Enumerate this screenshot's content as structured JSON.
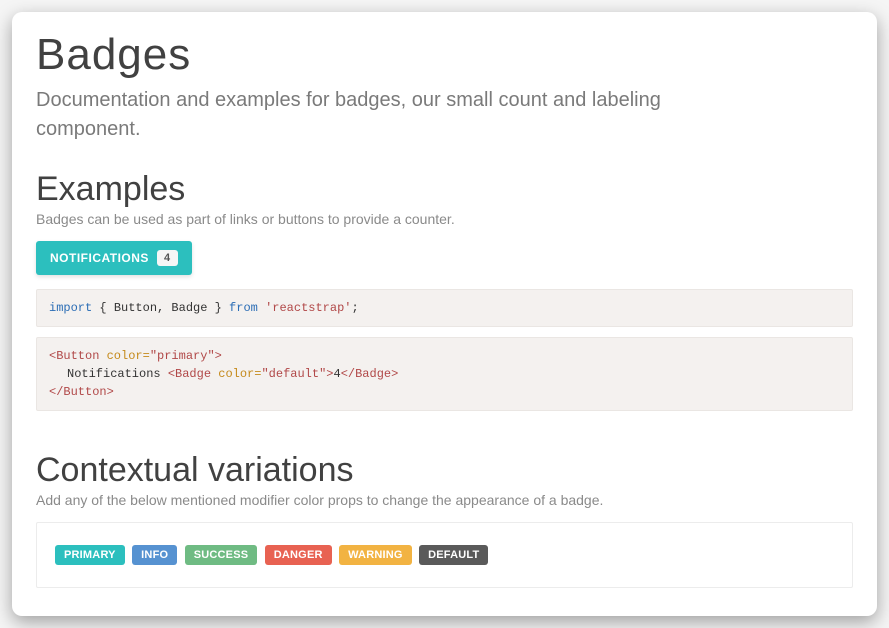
{
  "page": {
    "title": "Badges",
    "lead": "Documentation and examples for badges, our small count and labeling component."
  },
  "examples": {
    "heading": "Examples",
    "sub": "Badges can be used as part of links or buttons to provide a counter.",
    "button_label": "Notifications",
    "button_badge": "4"
  },
  "code": {
    "import_kw": "import",
    "import_items": "{ Button, Badge }",
    "from_kw": "from",
    "import_src": "'reactstrap'",
    "semi": ";",
    "btn_open": "<Button ",
    "attr_color": "color=",
    "val_primary": "\"primary\"",
    "gt": ">",
    "btn_text": "Notifications ",
    "badge_open": "<Badge ",
    "val_default": "\"default\"",
    "badge_content": "4",
    "badge_close": "</Badge>",
    "btn_close": "</Button>"
  },
  "contextual": {
    "heading": "Contextual variations",
    "sub": "Add any of the below mentioned modifier color props to change the appearance of a badge.",
    "badges": {
      "primary": "PRIMARY",
      "info": "INFO",
      "success": "SUCCESS",
      "danger": "DANGER",
      "warning": "WARNING",
      "default": "DEFAULT"
    }
  }
}
